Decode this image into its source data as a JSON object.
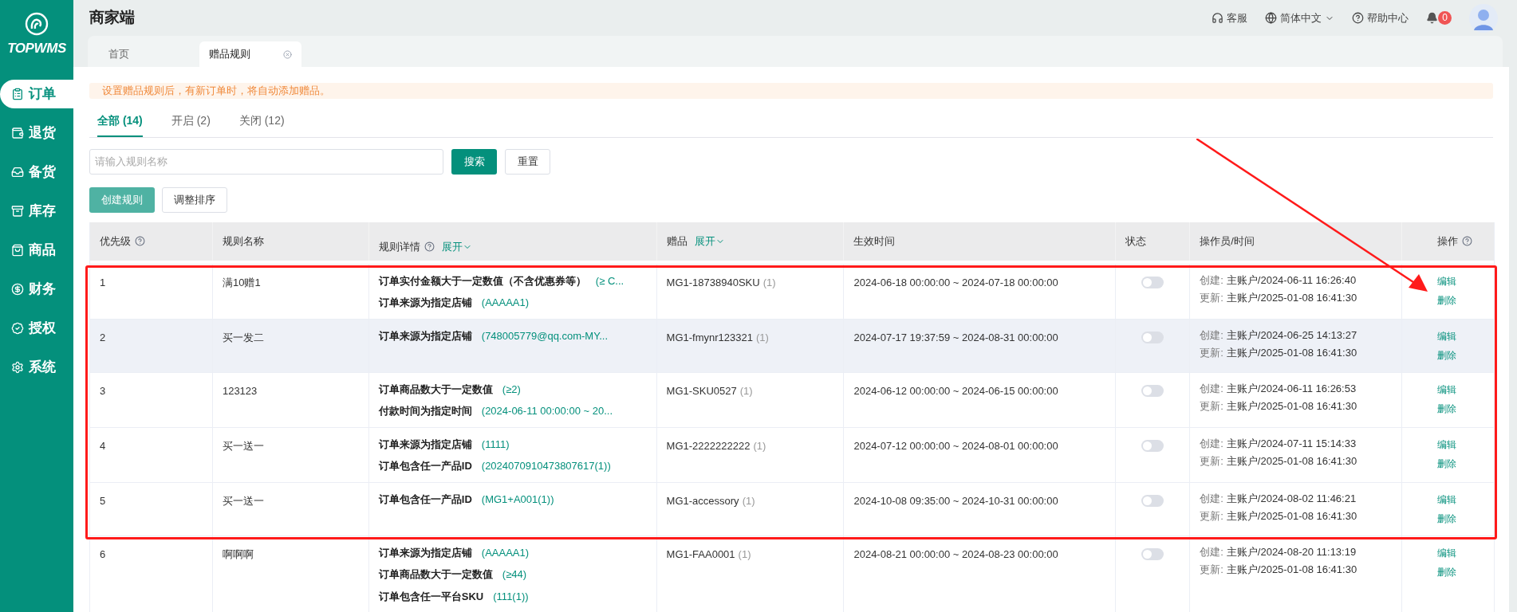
{
  "brand": {
    "name": "TOPWMS"
  },
  "sidebar": {
    "items": [
      {
        "label": "订单",
        "selected": true
      },
      {
        "label": "退货",
        "selected": false
      },
      {
        "label": "备货",
        "selected": false
      },
      {
        "label": "库存",
        "selected": false
      },
      {
        "label": "商品",
        "selected": false
      },
      {
        "label": "财务",
        "selected": false
      },
      {
        "label": "授权",
        "selected": false
      },
      {
        "label": "系统",
        "selected": false
      }
    ]
  },
  "header": {
    "title": "商家端",
    "service": "客服",
    "language": "简体中文",
    "help": "帮助中心",
    "notifications": "0"
  },
  "page_tabs": [
    {
      "label": "首页",
      "selected": false,
      "closable": false
    },
    {
      "label": "赠品规则",
      "selected": true,
      "closable": true
    }
  ],
  "alert": "设置赠品规则后，有新订单时，将自动添加赠品。",
  "status_tabs": [
    {
      "label": "全部 (14)",
      "selected": true
    },
    {
      "label": "开启 (2)",
      "selected": false
    },
    {
      "label": "关闭 (12)",
      "selected": false
    }
  ],
  "search": {
    "placeholder": "请输入规则名称",
    "search_button": "搜索",
    "reset_button": "重置"
  },
  "actions": {
    "create": "创建规则",
    "reorder": "调整排序"
  },
  "table": {
    "columns": [
      {
        "label": "优先级",
        "help": true
      },
      {
        "label": "规则名称"
      },
      {
        "label": "规则详情",
        "help": true,
        "expand": "展开"
      },
      {
        "label": "赠品",
        "expand": "展开"
      },
      {
        "label": "生效时间"
      },
      {
        "label": "状态"
      },
      {
        "label": "操作员/时间"
      },
      {
        "label": "操作",
        "help": true
      }
    ],
    "rows": [
      {
        "priority": "1",
        "name": "满10赠1",
        "details": [
          {
            "label": "订单实付金额大于一定数值（不含优惠券等）",
            "value": "(≥ C..."
          },
          {
            "label": "订单来源为指定店铺",
            "value": "(AAAAA1)"
          }
        ],
        "gift": "MG1-18738940SKU",
        "gift_count": "(1)",
        "period": "2024-06-18 00:00:00 ~ 2024-07-18 00:00:00",
        "on": false,
        "created_label": "创建:",
        "created": "主账户/2024-06-11 16:26:40",
        "updated_label": "更新:",
        "updated": "主账户/2025-01-08 16:41:30",
        "edit": "编辑",
        "delete": "删除",
        "highlighted": false
      },
      {
        "priority": "2",
        "name": "买一发二",
        "details": [
          {
            "label": "订单来源为指定店铺",
            "value": "(748005779@qq.com-MY..."
          }
        ],
        "gift": "MG1-fmynr123321",
        "gift_count": "(1)",
        "period": "2024-07-17 19:37:59 ~ 2024-08-31 00:00:00",
        "on": false,
        "created_label": "创建:",
        "created": "主账户/2024-06-25 14:13:27",
        "updated_label": "更新:",
        "updated": "主账户/2025-01-08 16:41:30",
        "edit": "编辑",
        "delete": "删除",
        "highlighted": true
      },
      {
        "priority": "3",
        "name": "123123",
        "details": [
          {
            "label": "订单商品数大于一定数值",
            "value": "(≥2)"
          },
          {
            "label": "付款时间为指定时间",
            "value": "(2024-06-11 00:00:00 ~ 20..."
          }
        ],
        "gift": "MG1-SKU0527",
        "gift_count": "(1)",
        "period": "2024-06-12 00:00:00 ~ 2024-06-15 00:00:00",
        "on": false,
        "created_label": "创建:",
        "created": "主账户/2024-06-11 16:26:53",
        "updated_label": "更新:",
        "updated": "主账户/2025-01-08 16:41:30",
        "edit": "编辑",
        "delete": "删除",
        "highlighted": false
      },
      {
        "priority": "4",
        "name": "买一送一",
        "details": [
          {
            "label": "订单来源为指定店铺",
            "value": "(1111)"
          },
          {
            "label": "订单包含任一产品ID",
            "value": "(2024070910473807617(1))"
          }
        ],
        "gift": "MG1-2222222222",
        "gift_count": "(1)",
        "period": "2024-07-12 00:00:00 ~ 2024-08-01 00:00:00",
        "on": false,
        "created_label": "创建:",
        "created": "主账户/2024-07-11 15:14:33",
        "updated_label": "更新:",
        "updated": "主账户/2025-01-08 16:41:30",
        "edit": "编辑",
        "delete": "删除",
        "highlighted": false
      },
      {
        "priority": "5",
        "name": "买一送一",
        "details": [
          {
            "label": "订单包含任一产品ID",
            "value": "(MG1+A001(1))"
          }
        ],
        "gift": "MG1-accessory",
        "gift_count": "(1)",
        "period": "2024-10-08 09:35:00 ~ 2024-10-31 00:00:00",
        "on": false,
        "created_label": "创建:",
        "created": "主账户/2024-08-02 11:46:21",
        "updated_label": "更新:",
        "updated": "主账户/2025-01-08 16:41:30",
        "edit": "编辑",
        "delete": "删除",
        "highlighted": false
      },
      {
        "priority": "6",
        "name": "啊啊啊",
        "details": [
          {
            "label": "订单来源为指定店铺",
            "value": "(AAAAA1)"
          },
          {
            "label": "订单商品数大于一定数值",
            "value": "(≥44)"
          },
          {
            "label": "订单包含任一平台SKU",
            "value": "(111(1))"
          }
        ],
        "gift": "MG1-FAA0001",
        "gift_count": "(1)",
        "period": "2024-08-21 00:00:00 ~ 2024-08-23 00:00:00",
        "on": false,
        "created_label": "创建:",
        "created": "主账户/2024-08-20 11:13:19",
        "updated_label": "更新:",
        "updated": "主账户/2025-01-08 16:41:30",
        "edit": "编辑",
        "delete": "删除",
        "highlighted": false
      }
    ]
  }
}
